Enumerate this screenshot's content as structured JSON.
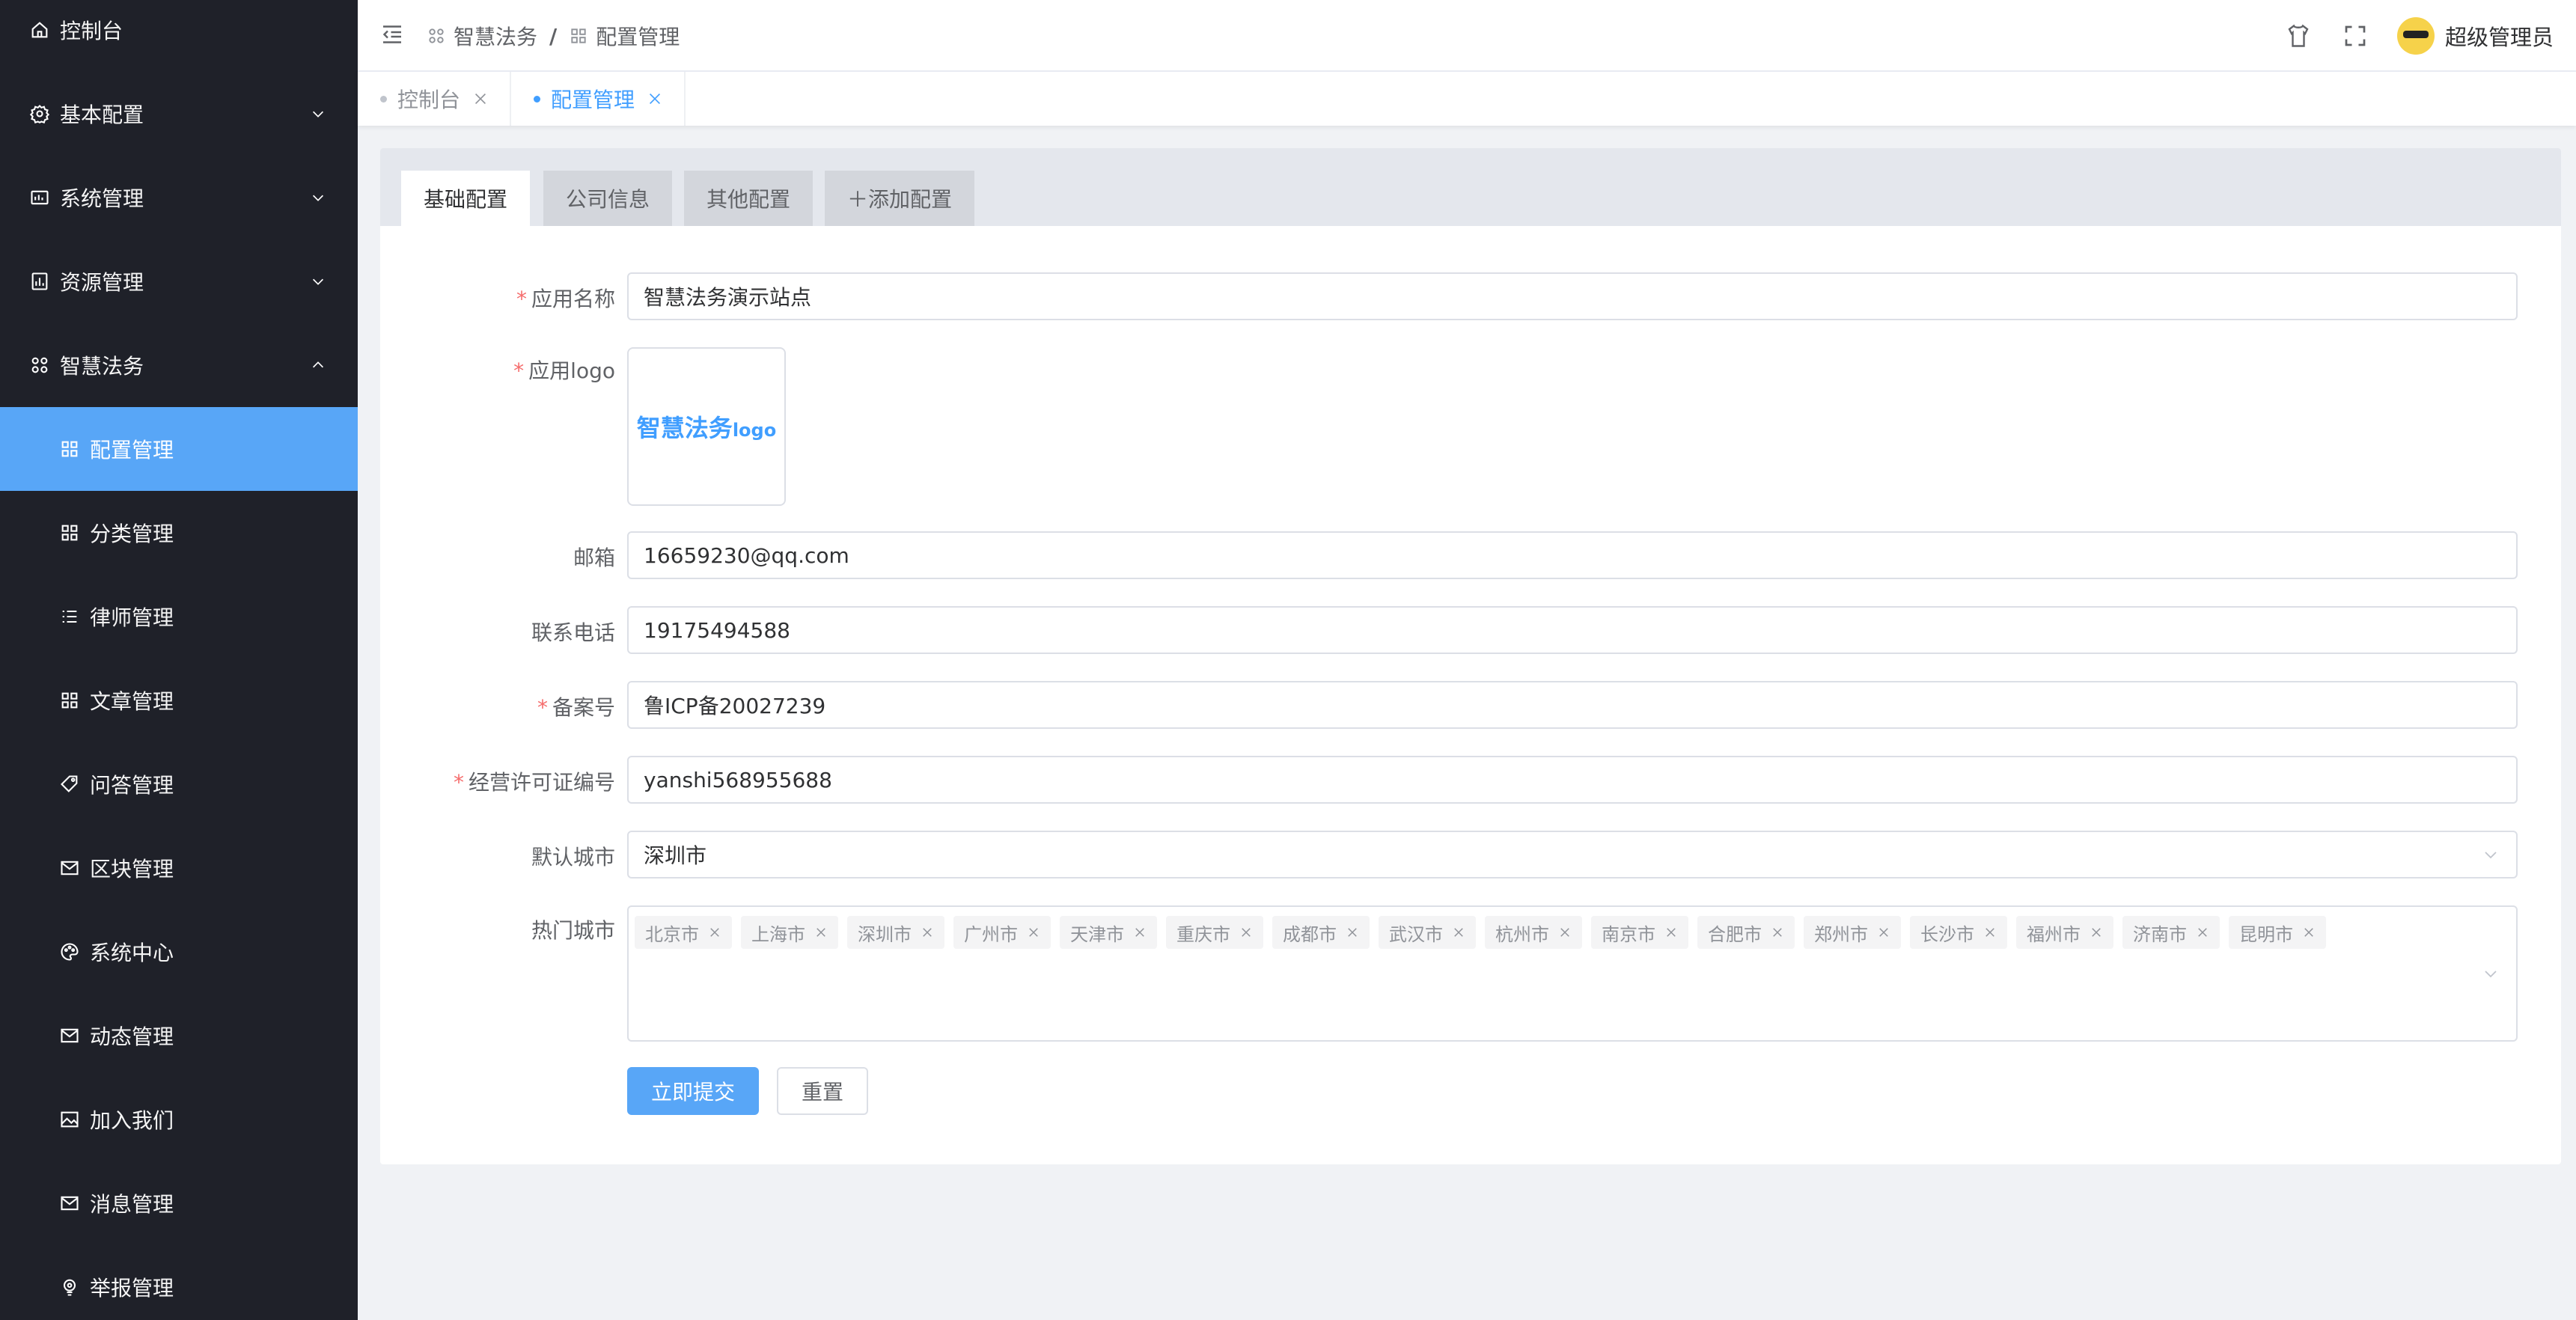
{
  "sidebar": {
    "items": [
      {
        "label": "控制台",
        "icon": "home-icon",
        "level": "top"
      },
      {
        "label": "基本配置",
        "icon": "gear-icon",
        "level": "top",
        "expandable": true,
        "expanded": false
      },
      {
        "label": "系统管理",
        "icon": "system-icon",
        "level": "top",
        "expandable": true,
        "expanded": false
      },
      {
        "label": "资源管理",
        "icon": "chart-icon",
        "level": "top",
        "expandable": true,
        "expanded": false
      },
      {
        "label": "智慧法务",
        "icon": "grid-icon",
        "level": "top",
        "expandable": true,
        "expanded": true
      },
      {
        "label": "配置管理",
        "icon": "grid-icon",
        "level": "sub",
        "active": true
      },
      {
        "label": "分类管理",
        "icon": "grid-icon",
        "level": "sub"
      },
      {
        "label": "律师管理",
        "icon": "list-icon",
        "level": "sub"
      },
      {
        "label": "文章管理",
        "icon": "grid-icon",
        "level": "sub"
      },
      {
        "label": "问答管理",
        "icon": "tag-icon",
        "level": "sub"
      },
      {
        "label": "区块管理",
        "icon": "mail-icon",
        "level": "sub"
      },
      {
        "label": "系统中心",
        "icon": "palette-icon",
        "level": "sub"
      },
      {
        "label": "动态管理",
        "icon": "mail-icon",
        "level": "sub"
      },
      {
        "label": "加入我们",
        "icon": "picture-icon",
        "level": "sub"
      },
      {
        "label": "消息管理",
        "icon": "mail-icon",
        "level": "sub"
      },
      {
        "label": "举报管理",
        "icon": "pin-icon",
        "level": "sub"
      }
    ]
  },
  "header": {
    "breadcrumb": [
      "智慧法务",
      "配置管理"
    ],
    "separator": "/",
    "username": "超级管理员"
  },
  "tags_view": [
    {
      "label": "控制台",
      "active": false
    },
    {
      "label": "配置管理",
      "active": true
    }
  ],
  "config_tabs": [
    "基础配置",
    "公司信息",
    "其他配置",
    "＋添加配置"
  ],
  "form": {
    "app_name": {
      "label": "应用名称",
      "required": true,
      "value": "智慧法务演示站点"
    },
    "app_logo": {
      "label": "应用logo",
      "required": true,
      "logo_text": "智慧法务",
      "logo_sub": "logo"
    },
    "email": {
      "label": "邮箱",
      "required": false,
      "value": "16659230@qq.com"
    },
    "phone": {
      "label": "联系电话",
      "required": false,
      "value": "19175494588"
    },
    "icp": {
      "label": "备案号",
      "required": true,
      "value": "鲁ICP备20027239"
    },
    "license": {
      "label": "经营许可证编号",
      "required": true,
      "value": "yanshi568955688"
    },
    "default_city": {
      "label": "默认城市",
      "required": false,
      "value": "深圳市"
    },
    "hot_cities": {
      "label": "热门城市",
      "required": false,
      "values": [
        "北京市",
        "上海市",
        "深圳市",
        "广州市",
        "天津市",
        "重庆市",
        "成都市",
        "武汉市",
        "杭州市",
        "南京市",
        "合肥市",
        "郑州市",
        "长沙市",
        "福州市",
        "济南市",
        "昆明市"
      ]
    },
    "submit_label": "立即提交",
    "reset_label": "重置"
  },
  "colors": {
    "sidebar_bg": "#1f2129",
    "sidebar_active": "#58a6f7",
    "primary": "#409eff",
    "required": "#f56c6c"
  }
}
